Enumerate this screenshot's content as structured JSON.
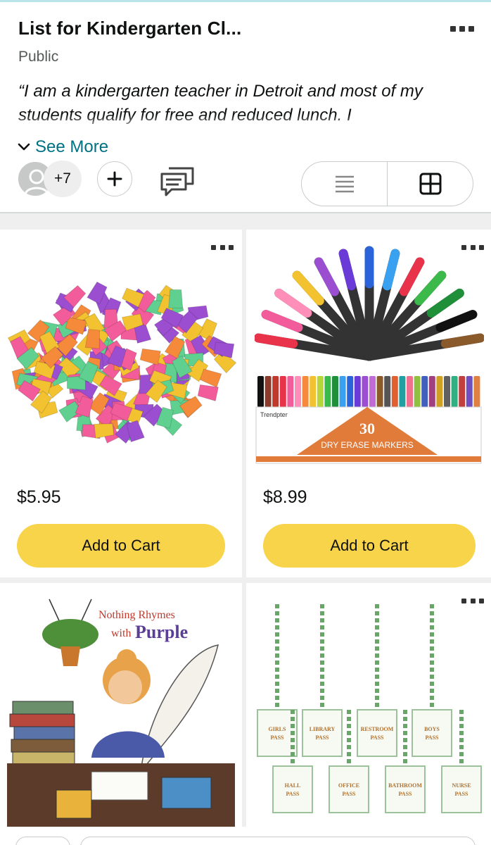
{
  "header": {
    "title": "List for Kindergarten Cl...",
    "visibility": "Public",
    "quote": "“I am a kindergarten teacher in Detroit and most of my students qualify for free and reduced lunch. I",
    "see_more": "See More",
    "collaborator_count": "+7",
    "add_icon": "plus-icon",
    "comment_icon": "comment-icon",
    "views": [
      "list-view-icon",
      "grid-view-icon"
    ],
    "selected_view": "grid"
  },
  "products": [
    {
      "name": "eraser-caps",
      "price": "$5.95",
      "cart_label": "Add to Cart"
    },
    {
      "name": "dry-erase-markers",
      "price": "$8.99",
      "cart_label": "Add to Cart",
      "box_brand": "Trendpter",
      "box_count": "30",
      "box_label": "DRY ERASE MARKERS"
    },
    {
      "name": "nothing-rhymes-with-purple-book",
      "book_title_1": "Nothing Rhymes",
      "book_title_2": "with",
      "book_title_3": "Purple"
    },
    {
      "name": "hall-passes",
      "passes": [
        "GIRLS PASS",
        "LIBRARY PASS",
        "RESTROOM PASS",
        "BOYS PASS",
        "HALL PASS",
        "OFFICE PASS",
        "BATHROOM PASS",
        "NURSE PASS"
      ]
    }
  ],
  "colors": {
    "accent_link": "#007185",
    "cart_button": "#f8d44a",
    "grid_background": "#efefef"
  }
}
